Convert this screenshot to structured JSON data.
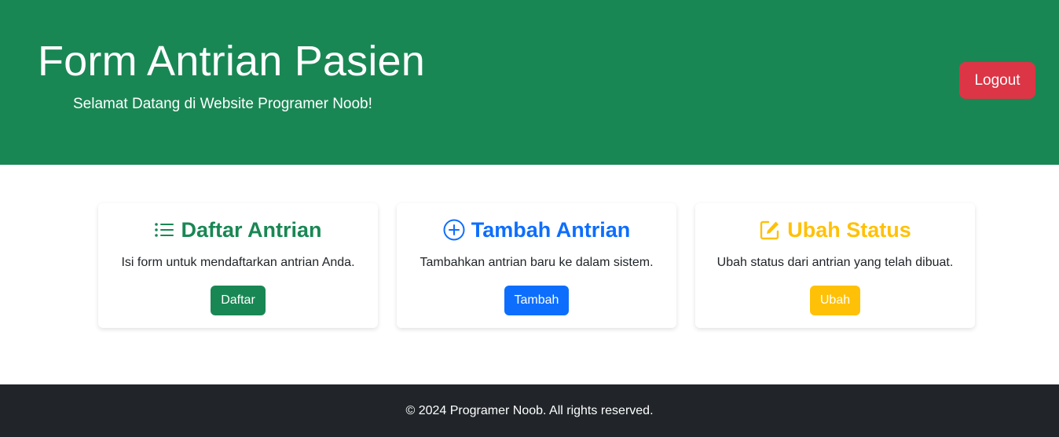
{
  "header": {
    "title": "Form Antrian Pasien",
    "subtitle": "Selamat Datang di Website Programer Noob!",
    "logout_label": "Logout"
  },
  "cards": [
    {
      "title": "Daftar Antrian",
      "text": "Isi form untuk mendaftarkan antrian Anda.",
      "button_label": "Daftar",
      "icon": "list-icon",
      "color": "#198754"
    },
    {
      "title": "Tambah Antrian",
      "text": "Tambahkan antrian baru ke dalam sistem.",
      "button_label": "Tambah",
      "icon": "plus-circle-icon",
      "color": "#0d6efd"
    },
    {
      "title": "Ubah Status",
      "text": "Ubah status dari antrian yang telah dibuat.",
      "button_label": "Ubah",
      "icon": "edit-icon",
      "color": "#ffc107"
    }
  ],
  "colors": {
    "header_bg": "#198754",
    "logout_bg": "#dc3545",
    "footer_bg": "#212529"
  },
  "footer": {
    "text": "© 2024 Programer Noob. All rights reserved."
  }
}
